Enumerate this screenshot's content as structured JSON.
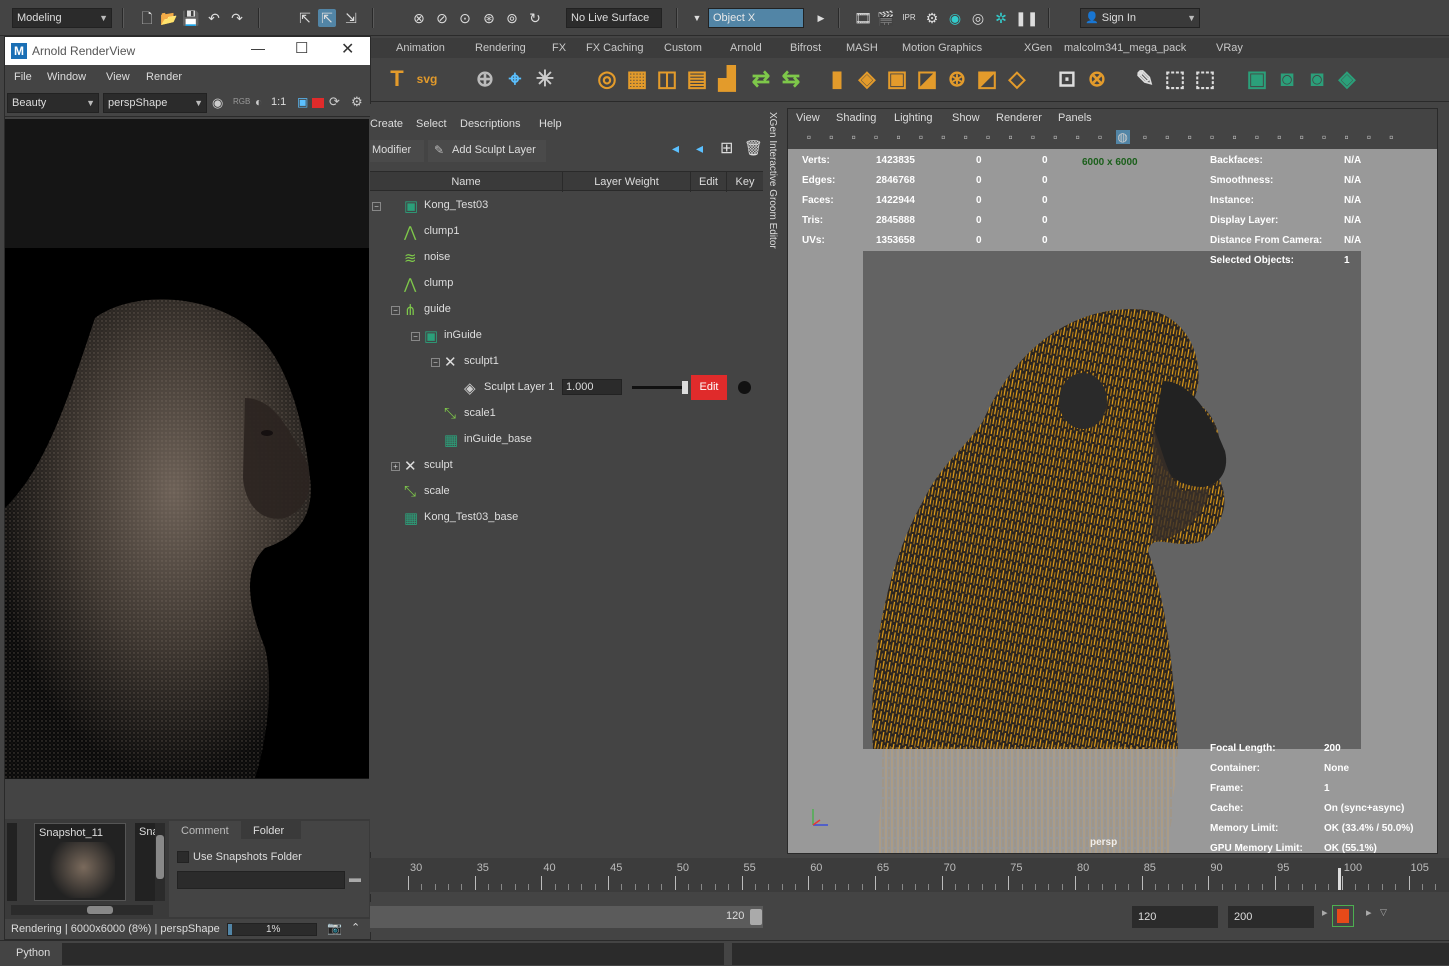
{
  "statusline": {
    "mode": "Modeling",
    "live_surface": "No Live Surface",
    "object_field": "Object X",
    "sign_in": "Sign In"
  },
  "shelf": {
    "tabs": [
      "Animation",
      "Rendering",
      "FX",
      "FX Caching",
      "Custom",
      "Arnold",
      "Bifrost",
      "MASH",
      "Motion Graphics",
      "XGen",
      "malcolm341_mega_pack",
      "VRay"
    ]
  },
  "arnold": {
    "title": "Arnold RenderView",
    "menus": [
      "File",
      "Window",
      "View",
      "Render"
    ],
    "aov": "Beauty",
    "camera": "perspShape",
    "ratio": "1:1",
    "snapshot_label": "Snapshot_11",
    "snapshot_label2": "Sna",
    "tabs": [
      "Comment",
      "Folder"
    ],
    "use_folder_label": "Use Snapshots Folder",
    "status": "Rendering | 6000x6000 (8%) | perspShape",
    "progress_text": "1%",
    "progress": 0.01
  },
  "xgen": {
    "menus": [
      "Create",
      "Select",
      "Descriptions",
      "Help"
    ],
    "modifier_btn": "Modifier",
    "add_sculpt_btn": "Add Sculpt Layer",
    "columns": [
      "Name",
      "Layer Weight",
      "Edit",
      "Key"
    ],
    "side_title": "XGen Interactive Groom Editor",
    "tree": [
      {
        "label": "Kong_Test03",
        "depth": 0,
        "icon": "description"
      },
      {
        "label": "clump1",
        "depth": 1,
        "icon": "clump"
      },
      {
        "label": "noise",
        "depth": 1,
        "icon": "noise"
      },
      {
        "label": "clump",
        "depth": 1,
        "icon": "clump"
      },
      {
        "label": "guide",
        "depth": 1,
        "icon": "guide"
      },
      {
        "label": "inGuide",
        "depth": 2,
        "icon": "description"
      },
      {
        "label": "sculpt1",
        "depth": 3,
        "icon": "sculpt"
      },
      {
        "label": "Sculpt Layer 1",
        "depth": 4,
        "icon": "layer"
      },
      {
        "label": "scale1",
        "depth": 3,
        "icon": "scale"
      },
      {
        "label": "inGuide_base",
        "depth": 3,
        "icon": "base"
      },
      {
        "label": "sculpt",
        "depth": 1,
        "icon": "sculpt"
      },
      {
        "label": "scale",
        "depth": 1,
        "icon": "scale"
      },
      {
        "label": "Kong_Test03_base",
        "depth": 1,
        "icon": "base"
      }
    ],
    "layer_weight": "1.000",
    "layer_weight_value": 1.0,
    "edit_label": "Edit"
  },
  "viewport": {
    "menus": [
      "View",
      "Shading",
      "Lighting",
      "Show",
      "Renderer",
      "Panels"
    ],
    "resolution": "6000 x 6000",
    "stats_left": [
      {
        "label": "Verts:",
        "v1": "1423835",
        "v2": "0",
        "v3": "0"
      },
      {
        "label": "Edges:",
        "v1": "2846768",
        "v2": "0",
        "v3": "0"
      },
      {
        "label": "Faces:",
        "v1": "1422944",
        "v2": "0",
        "v3": "0"
      },
      {
        "label": "Tris:",
        "v1": "2845888",
        "v2": "0",
        "v3": "0"
      },
      {
        "label": "UVs:",
        "v1": "1353658",
        "v2": "0",
        "v3": "0"
      }
    ],
    "stats_right": [
      {
        "label": "Backfaces:",
        "value": "N/A"
      },
      {
        "label": "Smoothness:",
        "value": "N/A"
      },
      {
        "label": "Instance:",
        "value": "N/A"
      },
      {
        "label": "Display Layer:",
        "value": "N/A"
      },
      {
        "label": "Distance From Camera:",
        "value": "N/A"
      },
      {
        "label": "Selected Objects:",
        "value": "1"
      }
    ],
    "stats_bottom": [
      {
        "label": "Focal Length:",
        "value": "200"
      },
      {
        "label": "Container:",
        "value": "None"
      },
      {
        "label": "Frame:",
        "value": "1"
      },
      {
        "label": "Cache:",
        "value": "On (sync+async)"
      },
      {
        "label": "Memory Limit:",
        "value": "OK (33.4% / 50.0%)"
      },
      {
        "label": "GPU Memory Limit:",
        "value": "OK (55.1%)"
      }
    ],
    "camera_name": "persp"
  },
  "timeline": {
    "ticks": [
      "30",
      "35",
      "40",
      "45",
      "50",
      "55",
      "60",
      "65",
      "70",
      "75",
      "80",
      "85",
      "90",
      "95",
      "100",
      "105"
    ],
    "range_end": "120",
    "start_field": "120",
    "end_field": "200"
  },
  "cmdline": {
    "label": "Python"
  },
  "colors": {
    "accent": "#5285a6",
    "edit_red": "#e02b2b",
    "fur": "#e8a21a"
  }
}
